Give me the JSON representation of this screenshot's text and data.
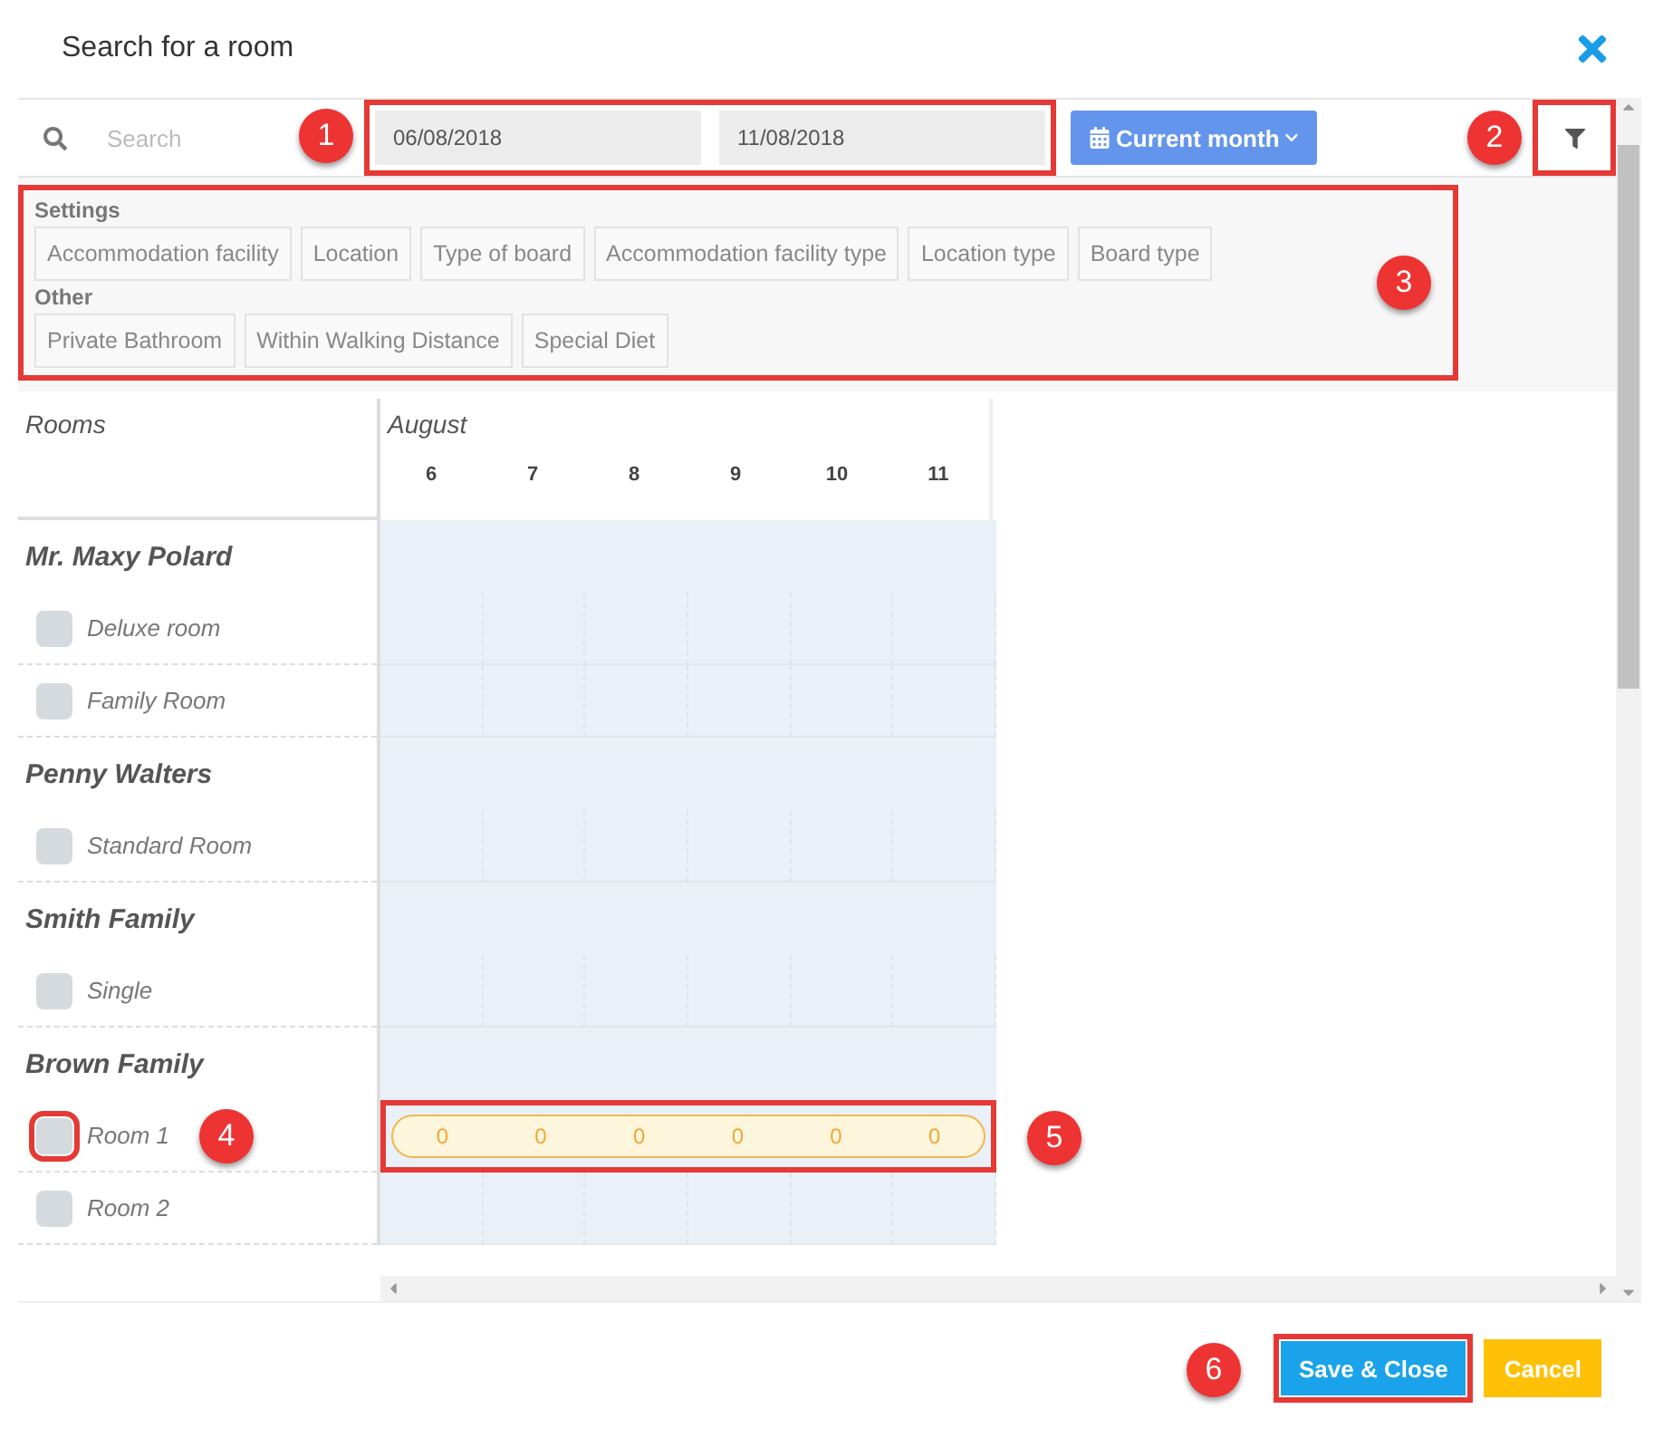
{
  "window": {
    "title": "Search for a room"
  },
  "toolbar": {
    "search": {
      "placeholder": "Search"
    },
    "dates": {
      "from": "06/08/2018",
      "to": "11/08/2018",
      "callout": "1"
    },
    "period_button": {
      "label": "Current month"
    },
    "filter_button": {
      "callout": "2"
    }
  },
  "filters": {
    "callout": "3",
    "sections": [
      {
        "title": "Settings",
        "tags": [
          "Accommodation facility",
          "Location",
          "Type of board",
          "Accommodation facility type",
          "Location type",
          "Board type"
        ]
      },
      {
        "title": "Other",
        "tags": [
          "Private Bathroom",
          "Within Walking Distance",
          "Special Diet"
        ]
      }
    ]
  },
  "calendar": {
    "rooms_heading": "Rooms",
    "month": "August",
    "days": [
      "6",
      "7",
      "8",
      "9",
      "10",
      "11"
    ],
    "groups": [
      {
        "name": "Mr. Maxy Polard",
        "rooms": [
          {
            "name": "Deluxe room",
            "checked": false
          },
          {
            "name": "Family Room",
            "checked": false
          }
        ]
      },
      {
        "name": "Penny Walters",
        "rooms": [
          {
            "name": "Standard Room",
            "checked": false
          }
        ]
      },
      {
        "name": "Smith Family",
        "rooms": [
          {
            "name": "Single",
            "checked": false
          }
        ]
      },
      {
        "name": "Brown Family",
        "rooms": [
          {
            "name": "Room 1",
            "checked": false,
            "callout": "4",
            "availability": [
              "0",
              "0",
              "0",
              "0",
              "0",
              "0"
            ],
            "availability_callout": "5"
          },
          {
            "name": "Room 2",
            "checked": false
          }
        ]
      }
    ]
  },
  "footer": {
    "save": {
      "label": "Save & Close",
      "callout": "6"
    },
    "cancel": {
      "label": "Cancel"
    }
  }
}
